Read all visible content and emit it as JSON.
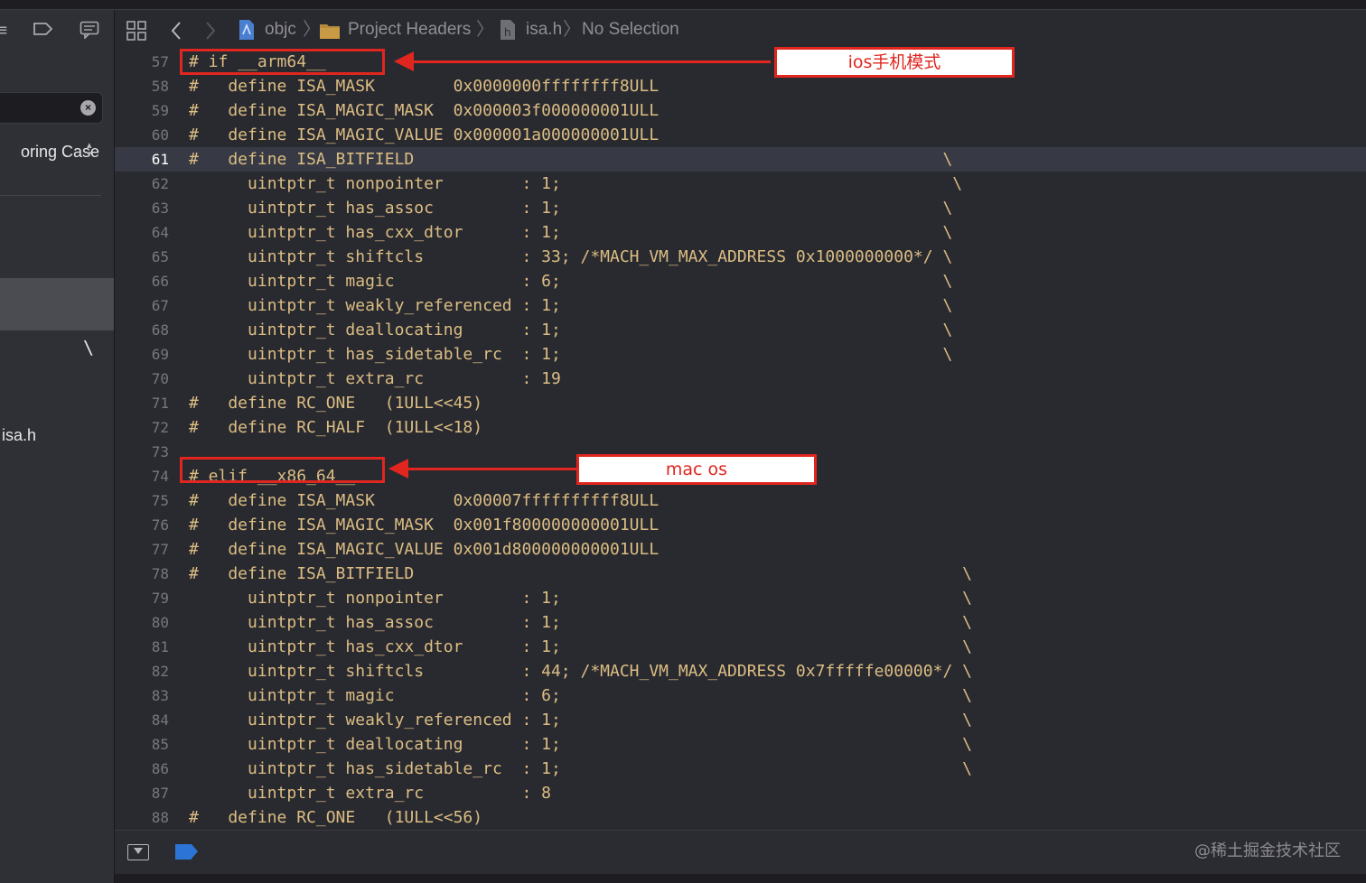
{
  "sidebar": {
    "matching_label": "oring Case",
    "selected_line_text": "\\",
    "file_name": "isa.h"
  },
  "jumpbar": {
    "project": "objc",
    "group": "Project Headers",
    "file": "isa.h",
    "symbol": "No Selection"
  },
  "annotations": {
    "arm64_label": "ios手机模式",
    "x86_label": "mac os"
  },
  "editor": {
    "current_line": 61,
    "lines": [
      {
        "n": "57",
        "text": "# if __arm64__"
      },
      {
        "n": "58",
        "text": "#   define ISA_MASK        0x0000000ffffffff8ULL"
      },
      {
        "n": "59",
        "text": "#   define ISA_MAGIC_MASK  0x000003f000000001ULL"
      },
      {
        "n": "60",
        "text": "#   define ISA_MAGIC_VALUE 0x000001a000000001ULL"
      },
      {
        "n": "61",
        "text": "#   define ISA_BITFIELD                                                      \\"
      },
      {
        "n": "62",
        "text": "      uintptr_t nonpointer        : 1;                                        \\"
      },
      {
        "n": "63",
        "text": "      uintptr_t has_assoc         : 1;                                       \\"
      },
      {
        "n": "64",
        "text": "      uintptr_t has_cxx_dtor      : 1;                                       \\"
      },
      {
        "n": "65",
        "text": "      uintptr_t shiftcls          : 33; /*MACH_VM_MAX_ADDRESS 0x1000000000*/ \\"
      },
      {
        "n": "66",
        "text": "      uintptr_t magic             : 6;                                       \\"
      },
      {
        "n": "67",
        "text": "      uintptr_t weakly_referenced : 1;                                       \\"
      },
      {
        "n": "68",
        "text": "      uintptr_t deallocating      : 1;                                       \\"
      },
      {
        "n": "69",
        "text": "      uintptr_t has_sidetable_rc  : 1;                                       \\"
      },
      {
        "n": "70",
        "text": "      uintptr_t extra_rc          : 19"
      },
      {
        "n": "71",
        "text": "#   define RC_ONE   (1ULL<<45)"
      },
      {
        "n": "72",
        "text": "#   define RC_HALF  (1ULL<<18)"
      },
      {
        "n": "73",
        "text": ""
      },
      {
        "n": "74",
        "text": "# elif __x86_64__"
      },
      {
        "n": "75",
        "text": "#   define ISA_MASK        0x00007ffffffffff8ULL"
      },
      {
        "n": "76",
        "text": "#   define ISA_MAGIC_MASK  0x001f800000000001ULL"
      },
      {
        "n": "77",
        "text": "#   define ISA_MAGIC_VALUE 0x001d800000000001ULL"
      },
      {
        "n": "78",
        "text": "#   define ISA_BITFIELD                                                        \\"
      },
      {
        "n": "79",
        "text": "      uintptr_t nonpointer        : 1;                                         \\"
      },
      {
        "n": "80",
        "text": "      uintptr_t has_assoc         : 1;                                         \\"
      },
      {
        "n": "81",
        "text": "      uintptr_t has_cxx_dtor      : 1;                                         \\"
      },
      {
        "n": "82",
        "text": "      uintptr_t shiftcls          : 44; /*MACH_VM_MAX_ADDRESS 0x7fffffe00000*/ \\"
      },
      {
        "n": "83",
        "text": "      uintptr_t magic             : 6;                                         \\"
      },
      {
        "n": "84",
        "text": "      uintptr_t weakly_referenced : 1;                                         \\"
      },
      {
        "n": "85",
        "text": "      uintptr_t deallocating      : 1;                                         \\"
      },
      {
        "n": "86",
        "text": "      uintptr_t has_sidetable_rc  : 1;                                         \\"
      },
      {
        "n": "87",
        "text": "      uintptr_t extra_rc          : 8"
      },
      {
        "n": "88",
        "text": "#   define RC_ONE   (1ULL<<56)"
      }
    ]
  },
  "watermark": "@稀土掘金技术社区",
  "colors": {
    "accent_red": "#e0261f",
    "code_text": "#dcbd83",
    "background": "#292a30"
  }
}
